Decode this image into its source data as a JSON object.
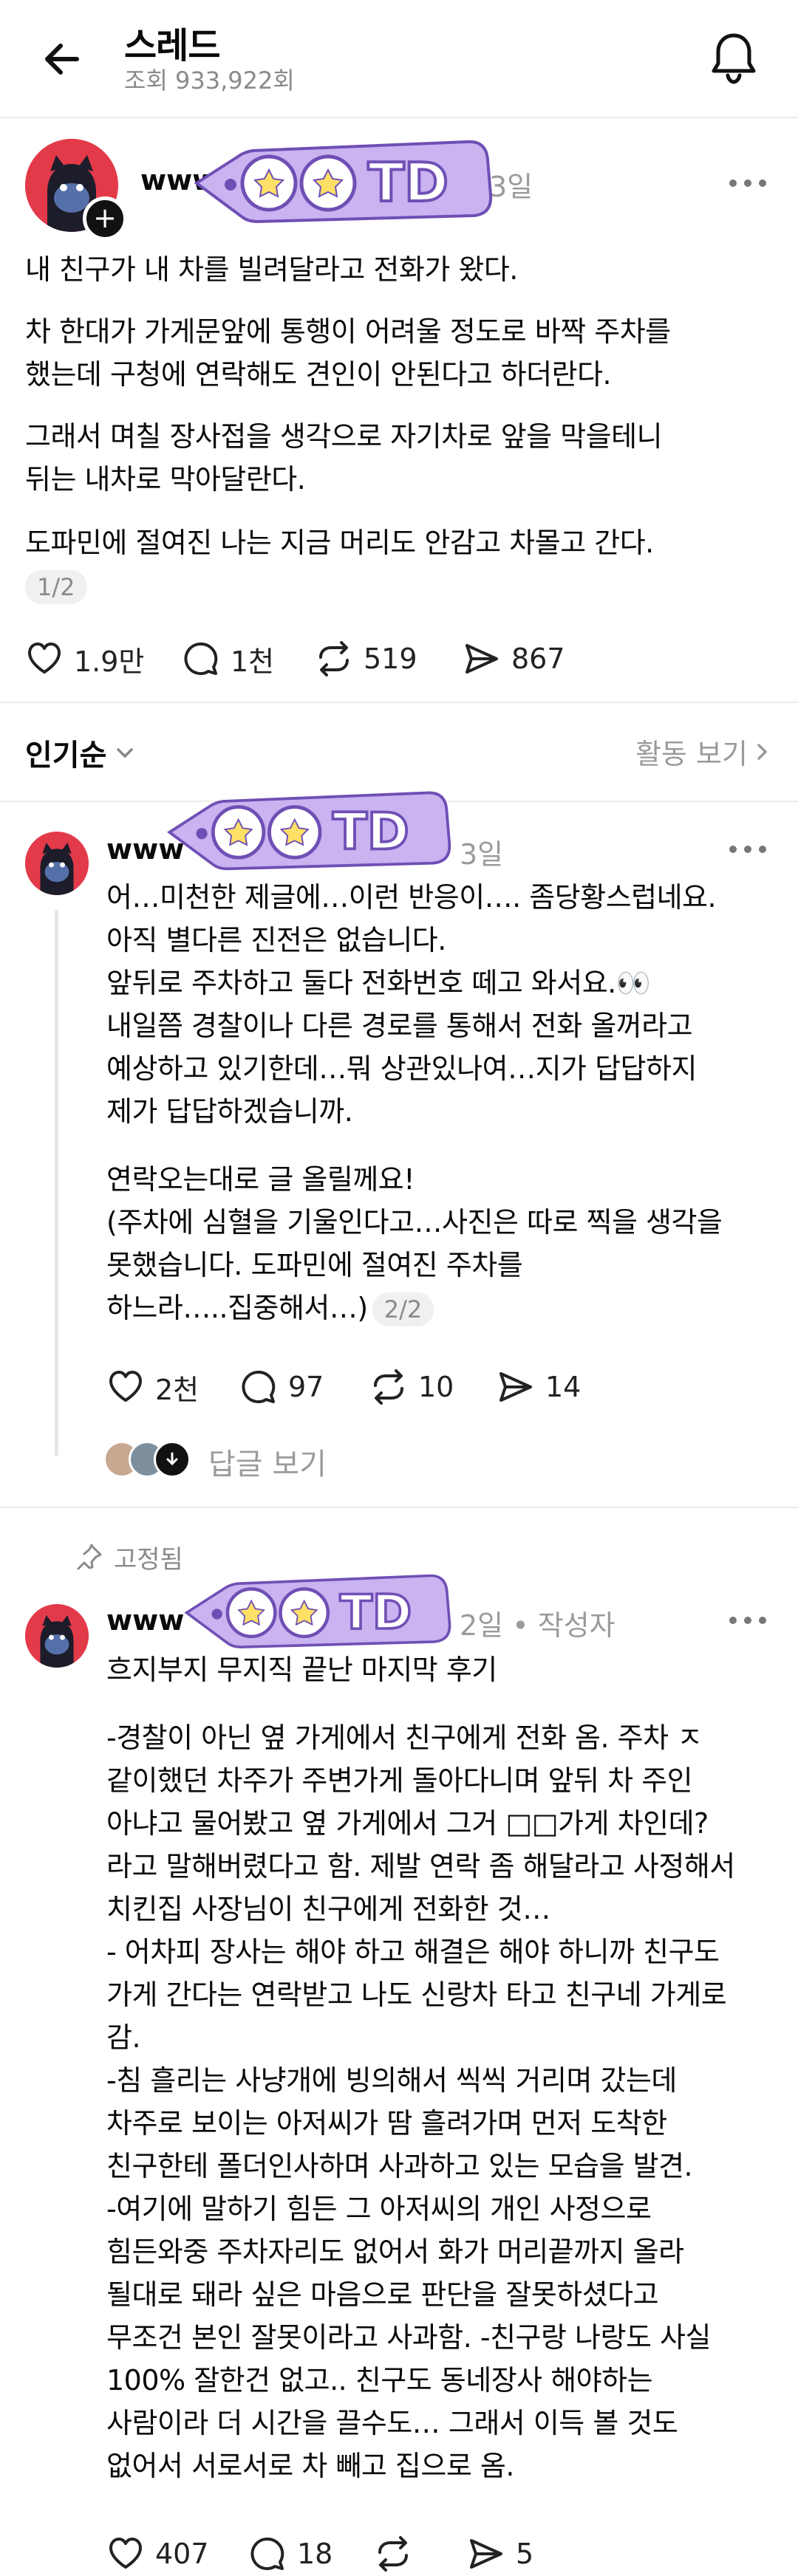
{
  "header": {
    "title": "스레드",
    "views": "조회 933,922회"
  },
  "post": {
    "username": "www",
    "time": "3일",
    "body": "내 친구가 내 차를 빌려달라고 전화가 왔다.",
    "body2": "차 한대가 가게문앞에 통행이 어려울 정도로 바짝 주차를\n했는데 구청에 연락해도 견인이 안된다고 하더란다.",
    "body3": "그래서 며칠 장사접을 생각으로 자기차로 앞을 막을테니\n뒤는 내차로 막아달란다.",
    "body4": "도파민에 절여진 나는 지금 머리도 안감고 차몰고 간다.",
    "page": "1/2",
    "likes": "1.9만",
    "comments": "1천",
    "reposts": "519",
    "shares": "867"
  },
  "sorting": {
    "sort_label": "인기순",
    "activity_label": "활동 보기"
  },
  "reply1": {
    "username": "www",
    "time": "3일",
    "body": "어…미천한 제글에…이런 반응이…. 좀당황스럽네요.\n아직 별다른 진전은 없습니다.\n앞뒤로 주차하고 둘다 전화번호 떼고 와서요.👀\n내일쯤 경찰이나 다른 경로를 통해서 전화 올꺼라고\n예상하고 있기한데…뭐 상관있나여…지가 답답하지\n제가 답답하겠습니까.",
    "body2": "연락오는대로 글 올릴께요!\n(주차에 심혈을 기울인다고…사진은 따로 찍을 생각을\n못했습니다. 도파민에 절여진 주차를\n하느라…..집중해서…)",
    "page": "2/2",
    "likes": "2천",
    "comments": "97",
    "reposts": "10",
    "shares": "14",
    "view_replies": "답글 보기"
  },
  "reply2": {
    "pinned_label": "고정됨",
    "username": "www",
    "time": "2일",
    "author_tag": "• 작성자",
    "title_line": "흐지부지 무지직 끝난 마지막 후기",
    "body": "-경찰이 아닌 옆 가게에서 친구에게 전화 옴.  주차 ㅈ\n같이했던 차주가 주변가게 돌아다니며 앞뒤 차 주인\n아냐고 물어봤고 옆 가게에서 그거 □□가게 차인데?\n라고 말해버렸다고 함. 제발 연락 좀 해달라고 사정해서\n치킨집 사장님이 친구에게 전화한 것…\n- 어차피 장사는 해야 하고 해결은 해야 하니까 친구도\n가게 간다는 연락받고 나도 신랑차 타고 친구네 가게로\n감.\n-침 흘리는 사냥개에 빙의해서 씩씩 거리며 갔는데\n차주로 보이는 아저씨가 땀 흘려가며 먼저 도착한\n친구한테 폴더인사하며 사과하고 있는 모습을 발견.\n-여기에 말하기 힘든 그 아저씨의 개인 사정으로\n힘든와중 주차자리도 없어서 화가 머리끝까지 올라\n될대로 돼라 싶은 마음으로 판단을 잘못하셨다고\n무조건 본인 잘못이라고 사과함. -친구랑 나랑도 사실\n100% 잘한건 없고.. 친구도 동네장사 해야하는\n사람이라 더 시간을 끌수도… 그래서 이득 볼 것도\n없어서 서로서로 차 빼고 집으로 옴.",
    "likes": "407",
    "comments": "18",
    "shares": "5"
  },
  "sticker_text": "TD",
  "colors": {
    "sticker_purple": "#c9b3f0",
    "sticker_outline": "#6f4fb5",
    "star_yellow": "#ffe066",
    "avatar_red": "#e33a4a"
  }
}
